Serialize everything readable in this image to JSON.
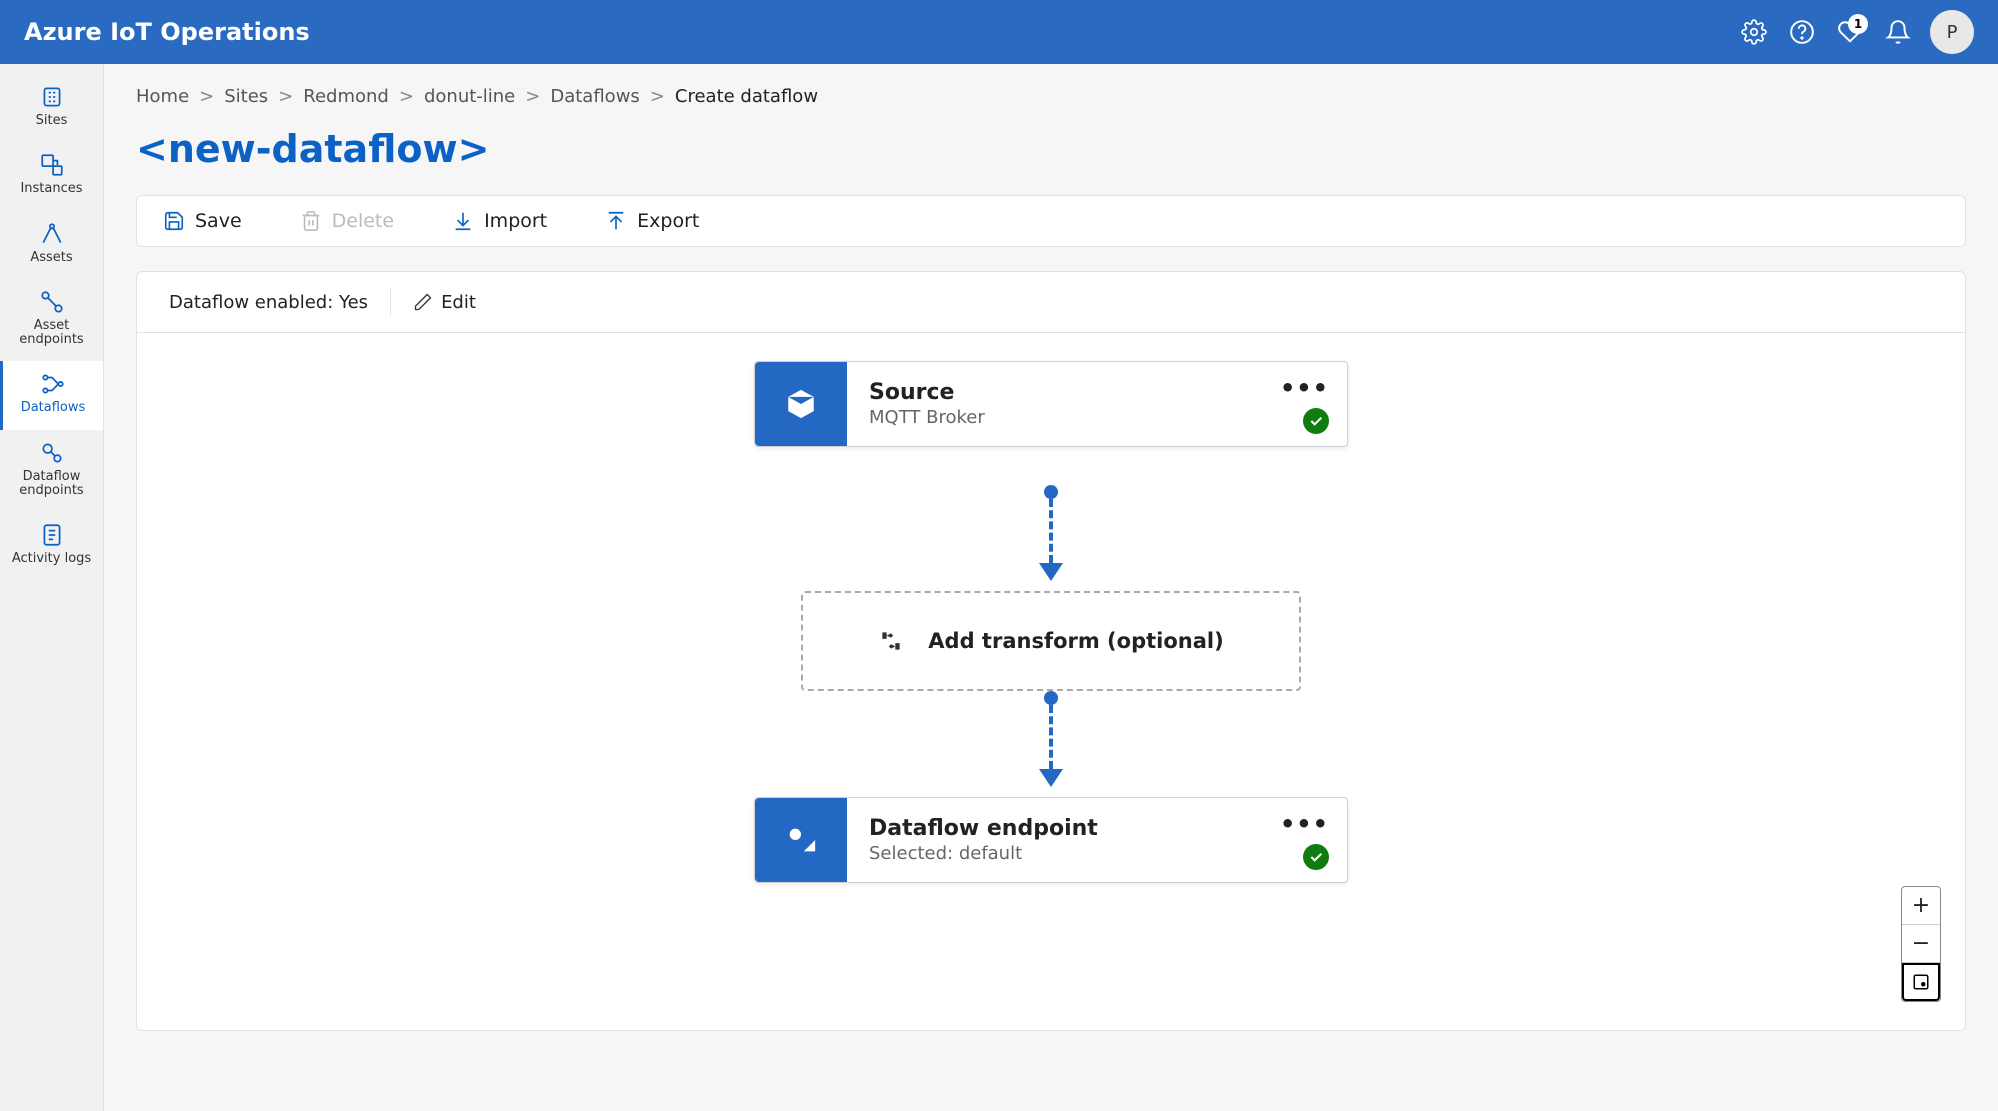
{
  "header": {
    "brand": "Azure IoT Operations",
    "notification_count": "1",
    "avatar_initial": "P"
  },
  "sidebar": {
    "items": [
      {
        "label": "Sites"
      },
      {
        "label": "Instances"
      },
      {
        "label": "Assets"
      },
      {
        "label": "Asset endpoints"
      },
      {
        "label": "Dataflows"
      },
      {
        "label": "Dataflow endpoints"
      },
      {
        "label": "Activity logs"
      }
    ]
  },
  "breadcrumb": {
    "items": [
      "Home",
      "Sites",
      "Redmond",
      "donut-line",
      "Dataflows"
    ],
    "current": "Create dataflow"
  },
  "page": {
    "title": "<new-dataflow>"
  },
  "toolbar": {
    "save": "Save",
    "delete": "Delete",
    "import": "Import",
    "export": "Export"
  },
  "status": {
    "label": "Dataflow enabled: Yes",
    "edit": "Edit"
  },
  "flow": {
    "source": {
      "title": "Source",
      "subtitle": "MQTT Broker"
    },
    "transform": {
      "label": "Add transform (optional)"
    },
    "endpoint": {
      "title": "Dataflow endpoint",
      "subtitle": "Selected: default"
    }
  }
}
